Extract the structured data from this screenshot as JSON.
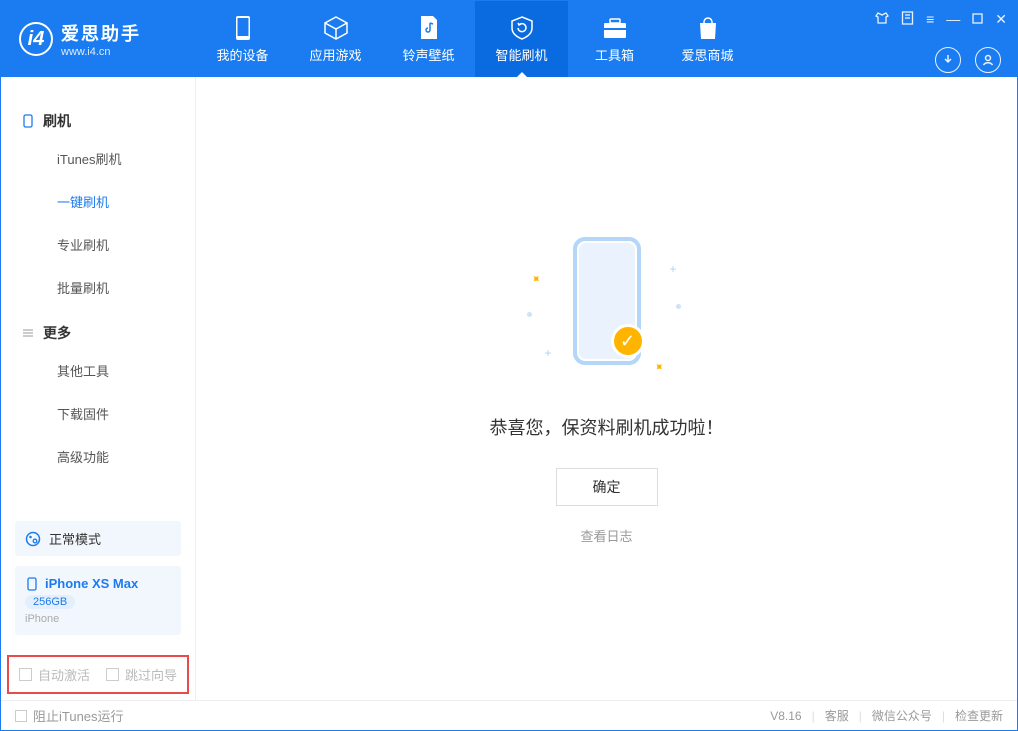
{
  "app": {
    "name": "爱思助手",
    "url": "www.i4.cn"
  },
  "nav": {
    "items": [
      {
        "label": "我的设备"
      },
      {
        "label": "应用游戏"
      },
      {
        "label": "铃声壁纸"
      },
      {
        "label": "智能刷机"
      },
      {
        "label": "工具箱"
      },
      {
        "label": "爱思商城"
      }
    ]
  },
  "sidebar": {
    "section1": {
      "title": "刷机",
      "items": [
        "iTunes刷机",
        "一键刷机",
        "专业刷机",
        "批量刷机"
      ]
    },
    "section2": {
      "title": "更多",
      "items": [
        "其他工具",
        "下载固件",
        "高级功能"
      ]
    }
  },
  "device": {
    "mode": "正常模式",
    "name": "iPhone XS Max",
    "capacity": "256GB",
    "type": "iPhone"
  },
  "checkboxes": {
    "auto_activate": "自动激活",
    "skip_guide": "跳过向导"
  },
  "main": {
    "success_text": "恭喜您，保资料刷机成功啦！",
    "ok_button": "确定",
    "view_log": "查看日志"
  },
  "footer": {
    "block_itunes": "阻止iTunes运行",
    "version": "V8.16",
    "links": [
      "客服",
      "微信公众号",
      "检查更新"
    ]
  }
}
